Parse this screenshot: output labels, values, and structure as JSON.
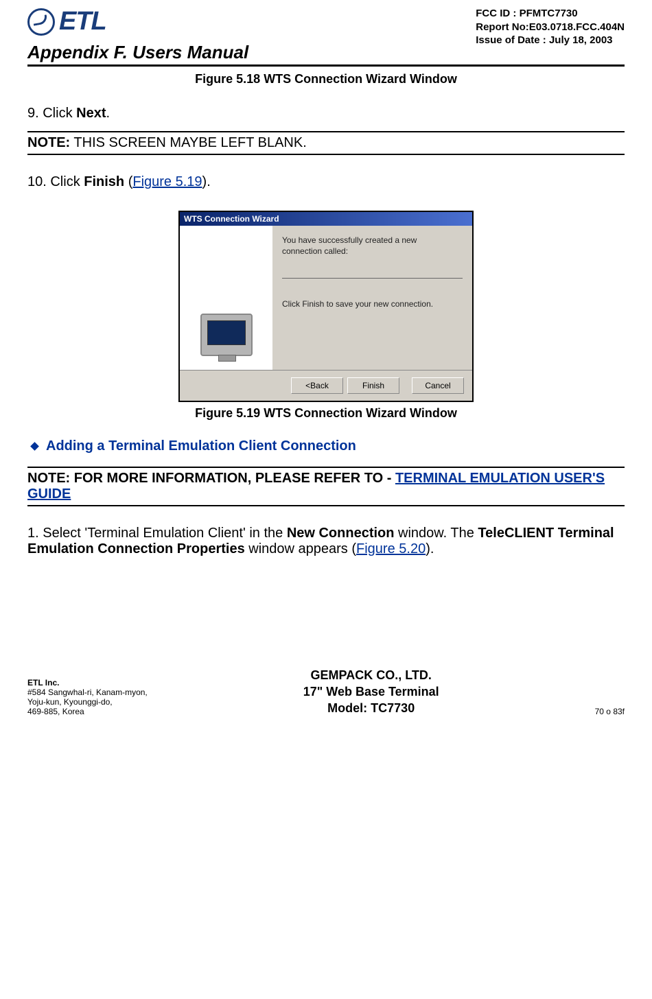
{
  "logo_text": "ETL",
  "header_meta": {
    "fcc": "FCC ID : PFMTC7730",
    "report": "Report No:E03.0718.FCC.404N",
    "issue": "Issue of Date : July 18, 2003"
  },
  "appendix_heading": "Appendix F.  Users Manual",
  "caption_518": "Figure 5.18    WTS Connection Wizard Window",
  "step9_prefix": "9.  Click ",
  "step9_bold": "Next",
  "step9_suffix": ".",
  "note1_label": "NOTE:",
  "note1_body": " THIS SCREEN MAYBE LEFT BLANK.",
  "step10_prefix": "10. Click ",
  "step10_bold": "Finish",
  "step10_paren_open": " (",
  "step10_link": "Figure 5.19",
  "step10_paren_close": ").",
  "wizard": {
    "title": "WTS Connection Wizard",
    "line1": "You have successfully created a new",
    "line2": "connection called:",
    "line3": "Click Finish to save your new connection.",
    "btn_back": "<Back",
    "btn_finish": "Finish",
    "btn_cancel": "Cancel"
  },
  "caption_519": "Figure 5.19    WTS Connection Wizard Window",
  "sec_heading": "Adding a Terminal Emulation Client Connection",
  "note2_label": "NOTE:  ",
  "note2_body": "FOR MORE INFORMATION, PLEASE REFER TO - ",
  "note2_link": "TERMINAL EMULATION USER'S GUIDE",
  "step1_prefix": "1.  Select 'Terminal Emulation Client' in the ",
  "step1_bold1": "New Connection",
  "step1_mid": " window.  The ",
  "step1_bold2": "TeleCLIENT Terminal Emulation Connection Properties",
  "step1_mid2": " window appears (",
  "step1_link": "Figure 5.20",
  "step1_end": ").",
  "footer": {
    "left1": "ETL Inc.",
    "left2": "#584 Sangwhal-ri, Kanam-myon,",
    "left3": "Yoju-kun, Kyounggi-do,",
    "left4": "469-885, Korea",
    "center1": "GEMPACK CO., LTD.",
    "center2": "17\" Web Base Terminal",
    "center3": "Model: TC7730",
    "right": "70 o 83f"
  }
}
